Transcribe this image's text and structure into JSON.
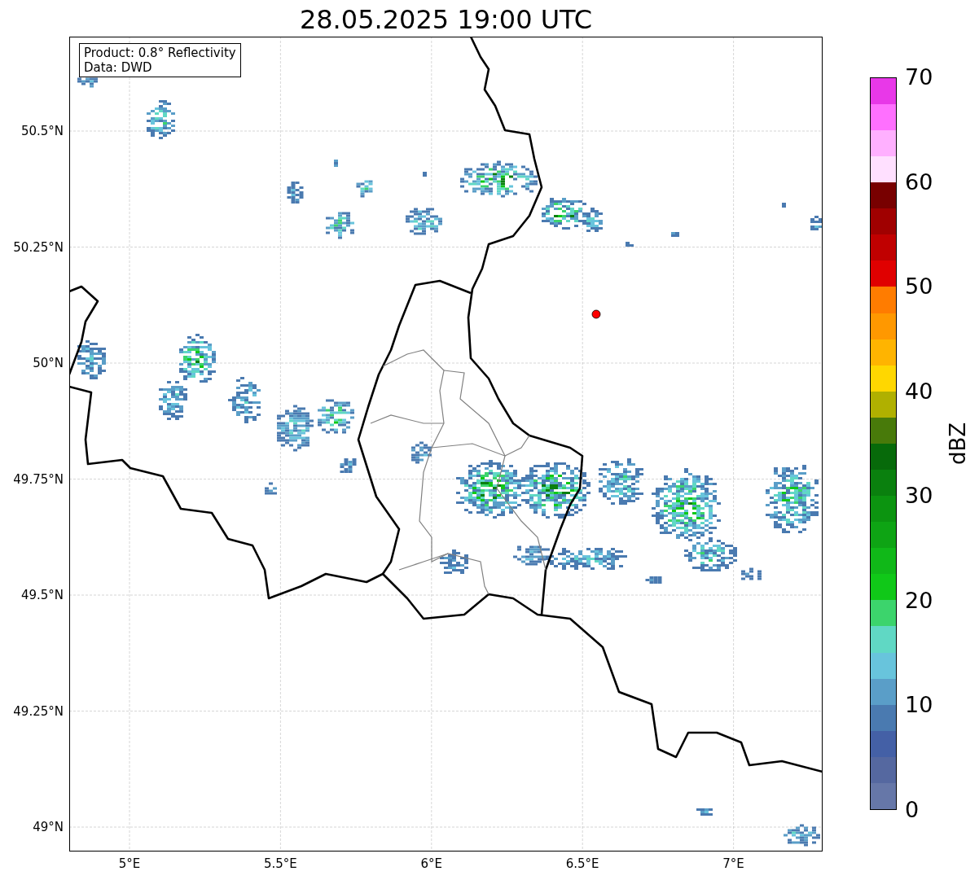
{
  "title": "28.05.2025 19:00 UTC",
  "info_box": {
    "lines": [
      "Product: 0.8° Reflectivity",
      "Data: DWD"
    ]
  },
  "map": {
    "x_ticks": [
      "5°E",
      "5.5°E",
      "6°E",
      "6.5°E",
      "7°E"
    ],
    "y_ticks": [
      "50.5°N",
      "50.25°N",
      "50°N",
      "49.75°N",
      "49.5°N",
      "49.25°N",
      "49°N"
    ]
  },
  "colorbar": {
    "label": "dBZ",
    "ticks": [
      "70",
      "60",
      "50",
      "40",
      "30",
      "20",
      "10",
      "0"
    ],
    "segments": [
      {
        "color": "#6677a8"
      },
      {
        "color": "#5568a0"
      },
      {
        "color": "#4460a6"
      },
      {
        "color": "#4a7ab0"
      },
      {
        "color": "#5a9ec8"
      },
      {
        "color": "#68c4dc"
      },
      {
        "color": "#60d8c4"
      },
      {
        "color": "#3cd46c"
      },
      {
        "color": "#10c818"
      },
      {
        "color": "#10b818"
      },
      {
        "color": "#0ea414"
      },
      {
        "color": "#0c9410"
      },
      {
        "color": "#0a800e"
      },
      {
        "color": "#076a0a"
      },
      {
        "color": "#487a0a"
      },
      {
        "color": "#b0b000"
      },
      {
        "color": "#ffd700"
      },
      {
        "color": "#ffb400"
      },
      {
        "color": "#ff9800"
      },
      {
        "color": "#ff7c00"
      },
      {
        "color": "#e00000"
      },
      {
        "color": "#c00000"
      },
      {
        "color": "#a00000"
      },
      {
        "color": "#780000"
      },
      {
        "color": "#ffe0ff"
      },
      {
        "color": "#ffb0ff"
      },
      {
        "color": "#ff70ff"
      },
      {
        "color": "#e838e8"
      }
    ]
  }
}
